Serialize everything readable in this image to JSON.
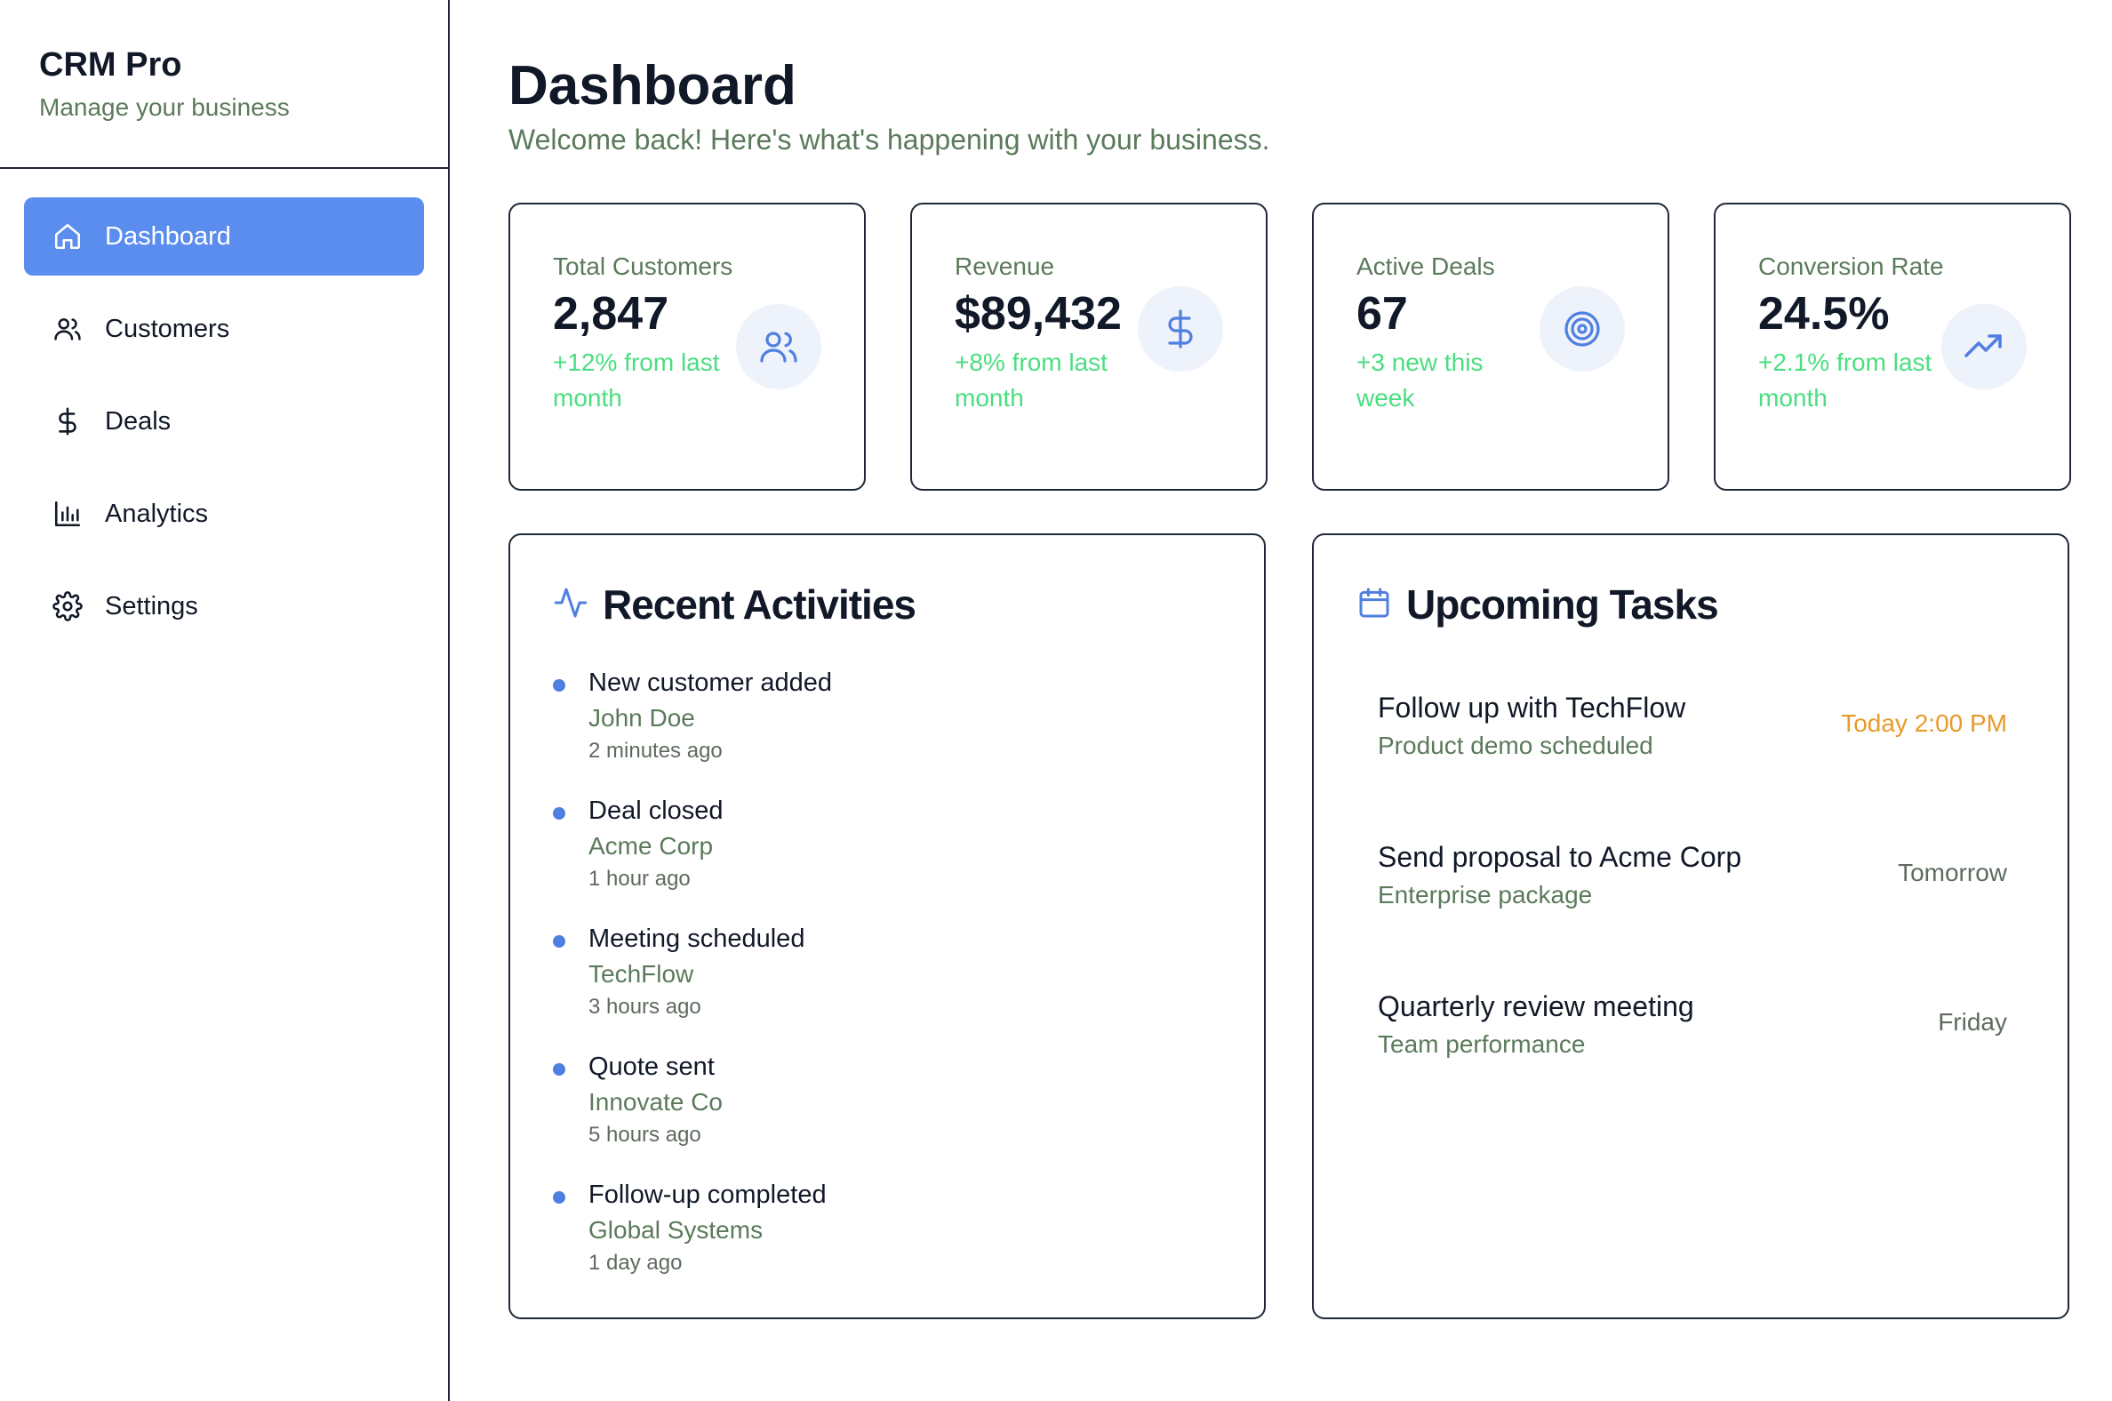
{
  "brand": {
    "title": "CRM Pro",
    "subtitle": "Manage your business"
  },
  "nav": {
    "items": [
      {
        "label": "Dashboard",
        "icon": "home-icon",
        "active": true
      },
      {
        "label": "Customers",
        "icon": "users-icon"
      },
      {
        "label": "Deals",
        "icon": "dollar-icon"
      },
      {
        "label": "Analytics",
        "icon": "bar-chart-icon"
      },
      {
        "label": "Settings",
        "icon": "gear-icon"
      }
    ]
  },
  "header": {
    "title": "Dashboard",
    "subtitle": "Welcome back! Here's what's happening with your business."
  },
  "stats": [
    {
      "label": "Total Customers",
      "value": "2,847",
      "change": "+12% from last month",
      "icon": "users-icon"
    },
    {
      "label": "Revenue",
      "value": "$89,432",
      "change": "+8% from last month",
      "icon": "dollar-icon"
    },
    {
      "label": "Active Deals",
      "value": "67",
      "change": "+3 new this week",
      "icon": "target-icon"
    },
    {
      "label": "Conversion Rate",
      "value": "24.5%",
      "change": "+2.1% from last month",
      "icon": "trending-up-icon"
    }
  ],
  "activities": {
    "title": "Recent Activities",
    "icon": "activity-icon",
    "items": [
      {
        "title": "New customer added",
        "subject": "John Doe",
        "time": "2 minutes ago"
      },
      {
        "title": "Deal closed",
        "subject": "Acme Corp",
        "time": "1 hour ago"
      },
      {
        "title": "Meeting scheduled",
        "subject": "TechFlow",
        "time": "3 hours ago"
      },
      {
        "title": "Quote sent",
        "subject": "Innovate Co",
        "time": "5 hours ago"
      },
      {
        "title": "Follow-up completed",
        "subject": "Global Systems",
        "time": "1 day ago"
      }
    ]
  },
  "tasks": {
    "title": "Upcoming Tasks",
    "icon": "calendar-icon",
    "items": [
      {
        "title": "Follow up with TechFlow",
        "detail": "Product demo scheduled",
        "when": "Today 2:00 PM",
        "urgent": true
      },
      {
        "title": "Send proposal to Acme Corp",
        "detail": "Enterprise package",
        "when": "Tomorrow"
      },
      {
        "title": "Quarterly review meeting",
        "detail": "Team performance",
        "when": "Friday"
      }
    ]
  },
  "colors": {
    "accent": "#5b8def",
    "positive": "#4ade80",
    "muted_green": "#5b7a5b",
    "urgent": "#e89a2a",
    "border": "#1f2937"
  }
}
